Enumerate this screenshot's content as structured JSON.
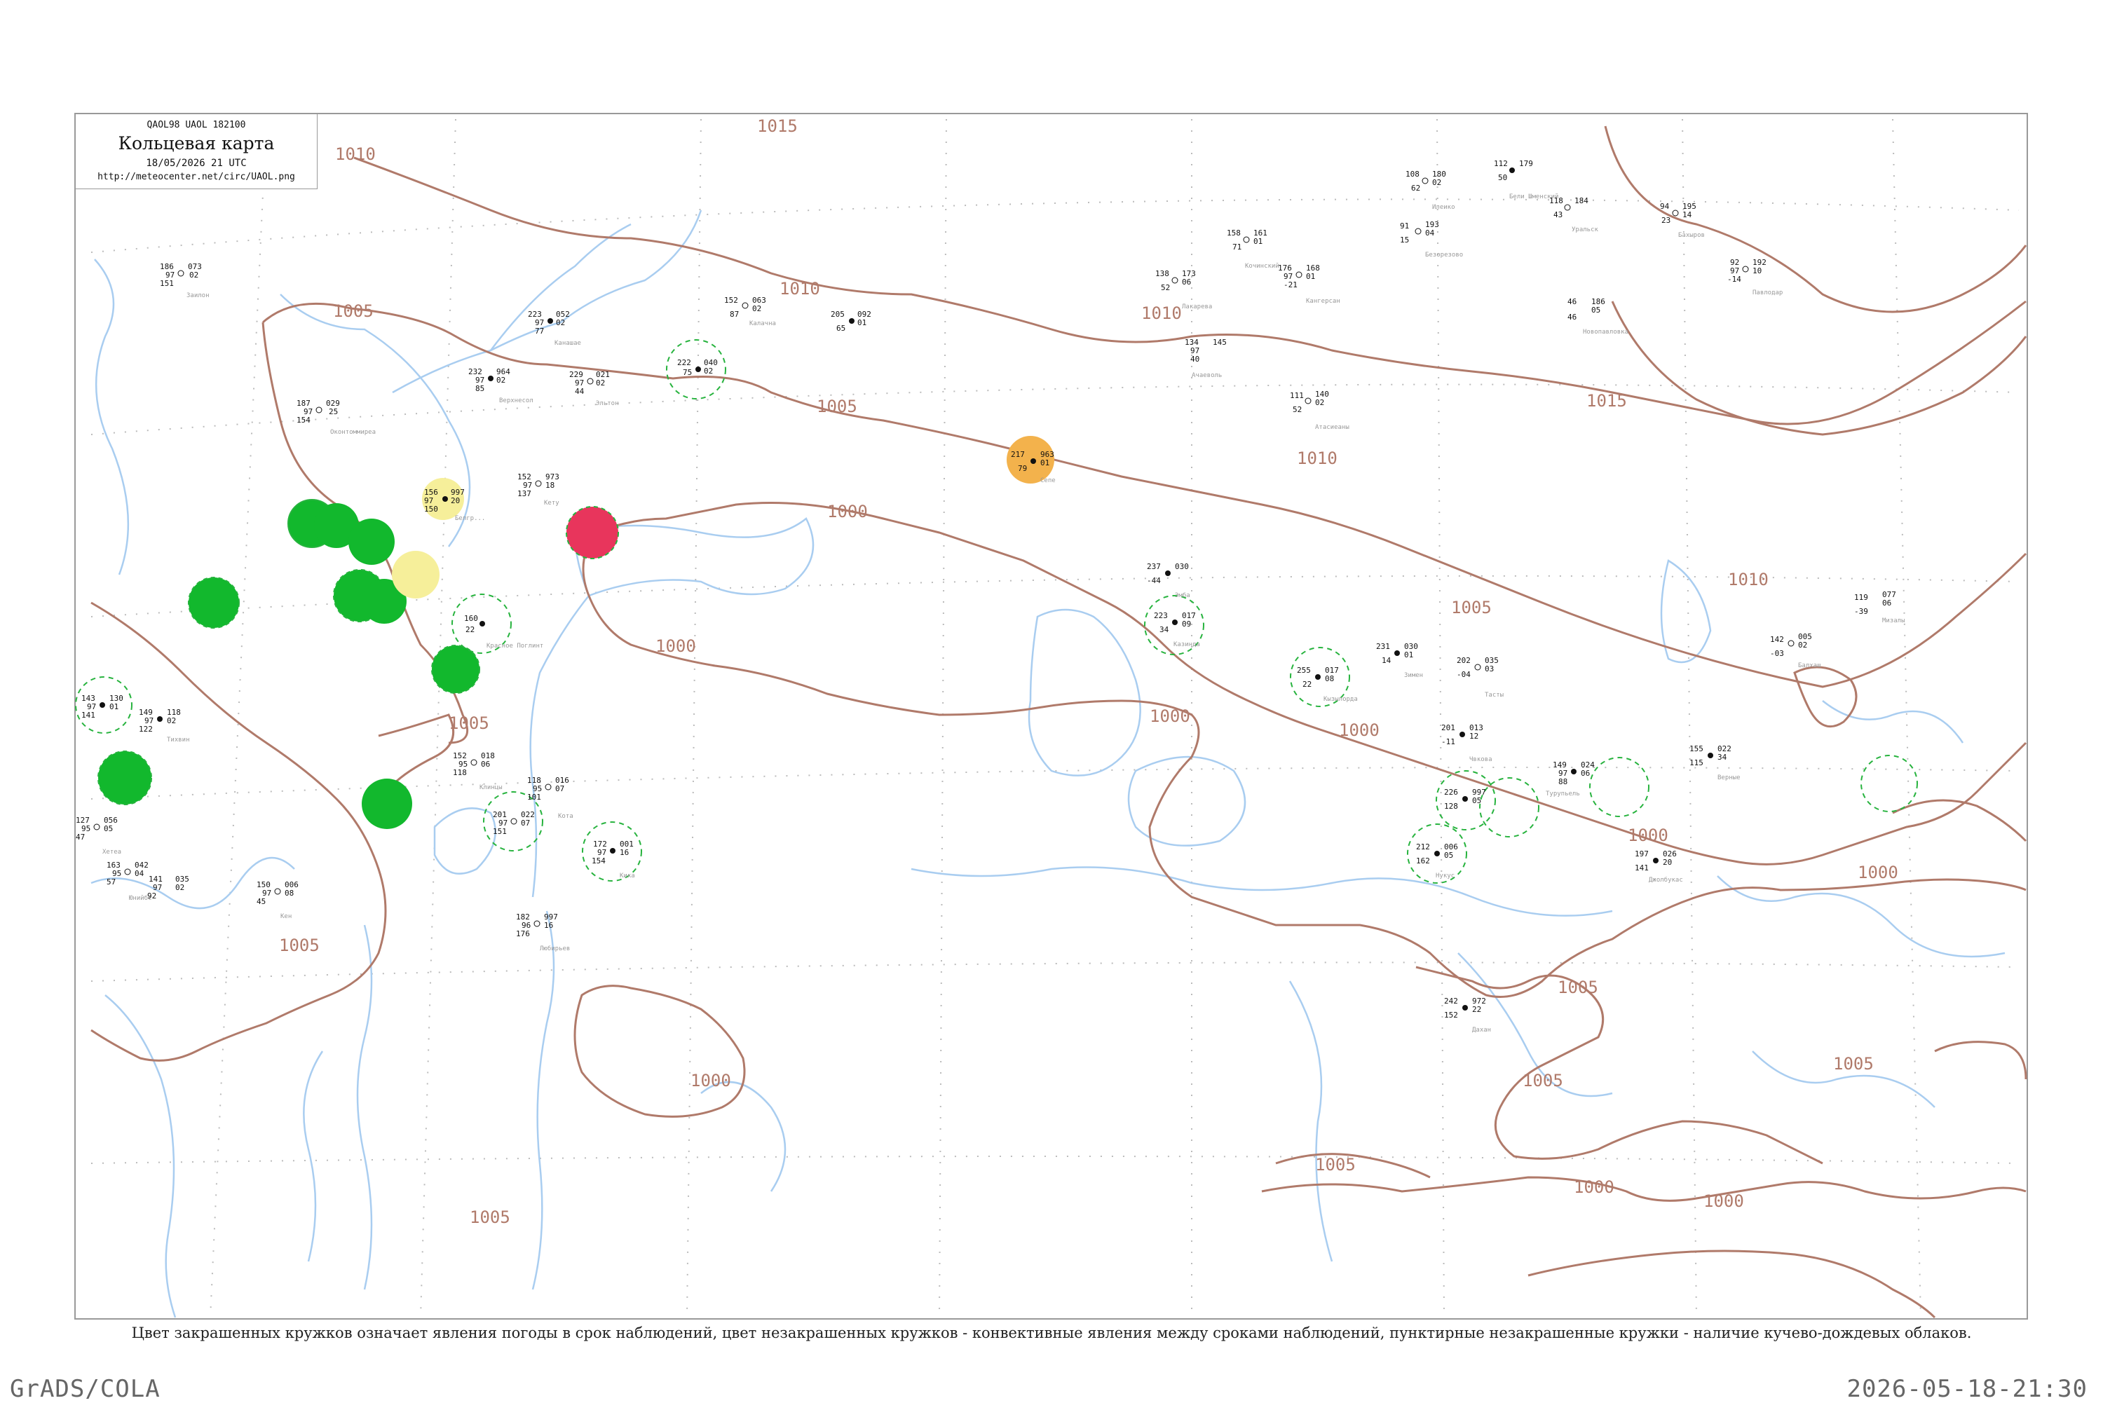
{
  "header": {
    "code": "QAOL98  UAOL  182100",
    "title": "Кольцевая карта",
    "date": "18/05/2026 21 UTC",
    "url": "http://meteocenter.net/circ/UAOL.png"
  },
  "caption": "Цвет закрашенных кружков означает явления погоды в срок наблюдений, цвет незакрашенных кружков - конвективные явления между сроками наблюдений, пунктирные незакрашенные кружки - наличие кучево-дождевых облаков.",
  "footer": {
    "left": "GrADS/COLA",
    "right": "2026-05-18-21:30"
  },
  "colors": {
    "isobar": "#b07a6a",
    "river": "#a9cdf0",
    "grid": "#bbbbbb",
    "green": "#12b82d",
    "yellow": "#f6ef9a",
    "orange": "#f3b24c",
    "red": "#e8355c",
    "dashed_ring": "#27b33e"
  },
  "isobar_labels": [
    "1015",
    "1010",
    "1005",
    "1010",
    "1005",
    "1010",
    "1005",
    "1015",
    "1010",
    "1000",
    "1010",
    "1005",
    "1000",
    "1000",
    "1000",
    "1000",
    "1005",
    "1000",
    "1005",
    "1005",
    "1005",
    "1005",
    "1005",
    "1000",
    "1000",
    "1000"
  ],
  "stations": [
    {
      "p": "186",
      "t": "97",
      "d": "151",
      "n": "073",
      "tend": "02",
      "w": "",
      "name": "Заилон"
    },
    {
      "p": "223",
      "t": "97",
      "d": "77",
      "n": "052",
      "tend": "02",
      "w": "",
      "name": "Канашае"
    },
    {
      "p": "152",
      "t": "87",
      "d": "",
      "n": "063",
      "tend": "02",
      "w": "",
      "name": "Калачна"
    },
    {
      "p": "205",
      "t": "65",
      "d": "",
      "n": "092",
      "tend": "01",
      "w": "",
      "name": ""
    },
    {
      "p": "232",
      "t": "97",
      "d": "85",
      "n": "964",
      "tend": "02",
      "w": "",
      "name": "Верхнесол"
    },
    {
      "p": "229",
      "t": "97",
      "d": "44",
      "n": "021",
      "tend": "02",
      "w": "",
      "name": "Эльтон"
    },
    {
      "p": "222",
      "t": "75",
      "d": "",
      "n": "040",
      "tend": "02",
      "w": "",
      "name": ""
    },
    {
      "p": "187",
      "t": "97",
      "d": "154",
      "n": "029",
      "tend": "25",
      "w": "",
      "name": "Оконтоммиреа"
    },
    {
      "p": "156",
      "t": "97",
      "d": "150",
      "n": "997",
      "tend": "20",
      "w": "",
      "name": "Белгр..."
    },
    {
      "p": "152",
      "t": "97",
      "d": "137",
      "n": "973",
      "tend": "18",
      "w": "",
      "name": "Кету"
    },
    {
      "p": "217",
      "t": "79",
      "d": "",
      "n": "963",
      "tend": "01",
      "w": "",
      "name": "Сепе"
    },
    {
      "p": "108",
      "t": "62",
      "d": "",
      "n": "180",
      "tend": "02",
      "w": "",
      "name": "Илеико"
    },
    {
      "p": "112",
      "t": "50",
      "d": "",
      "n": "179",
      "tend": "",
      "w": "",
      "name": "Бели Шменский"
    },
    {
      "p": "118",
      "t": "43",
      "d": "",
      "n": "184",
      "tend": "",
      "w": "",
      "name": "Уральск"
    },
    {
      "p": "94",
      "t": "23",
      "d": "",
      "n": "195",
      "tend": "14",
      "w": "",
      "name": "Бахыров"
    },
    {
      "p": "158",
      "t": "71",
      "d": "",
      "n": "161",
      "tend": "01",
      "w": "",
      "name": "Кочинский"
    },
    {
      "p": "176",
      "t": "97",
      "d": "-21",
      "n": "168",
      "tend": "01",
      "w": "",
      "name": "Кангерсан"
    },
    {
      "p": "138",
      "t": "52",
      "d": "",
      "n": "173",
      "tend": "06",
      "w": "",
      "name": "Лакарева"
    },
    {
      "p": "91",
      "t": "15",
      "d": "",
      "n": "193",
      "tend": "04",
      "w": "",
      "name": "Безорезово"
    },
    {
      "p": "92",
      "t": "97",
      "d": "-14",
      "n": "192",
      "tend": "10",
      "w": "",
      "name": "Павлодар"
    },
    {
      "p": "46",
      "t": "46",
      "d": "",
      "n": "186",
      "tend": "05",
      "w": "",
      "name": "Новопавловка"
    },
    {
      "p": "134",
      "t": "97",
      "d": "40",
      "n": "145",
      "tend": "",
      "w": "",
      "name": "Ачаеволь"
    },
    {
      "p": "111",
      "t": "52",
      "d": "",
      "n": "140",
      "tend": "02",
      "w": "",
      "name": "Атасиеаны"
    },
    {
      "p": "237",
      "t": "-44",
      "d": "",
      "n": "030",
      "tend": "",
      "w": "",
      "name": "Эмба"
    },
    {
      "p": "223",
      "t": "34",
      "d": "",
      "n": "017",
      "tend": "09",
      "w": "",
      "name": "Казинда"
    },
    {
      "p": "255",
      "t": "22",
      "d": "",
      "n": "017",
      "tend": "08",
      "w": "",
      "name": "Кызылорда"
    },
    {
      "p": "231",
      "t": "14",
      "d": "",
      "n": "030",
      "tend": "01",
      "w": "",
      "name": "Зимен"
    },
    {
      "p": "202",
      "t": "-04",
      "d": "",
      "n": "035",
      "tend": "03",
      "w": "",
      "name": "Тасты"
    },
    {
      "p": "201",
      "t": "-11",
      "d": "",
      "n": "013",
      "tend": "12",
      "w": "",
      "name": "Чвкова"
    },
    {
      "p": "226",
      "t": "128",
      "d": "",
      "n": "997",
      "tend": "05",
      "w": "",
      "name": ""
    },
    {
      "p": "149",
      "t": "97",
      "d": "88",
      "n": "024",
      "tend": "06",
      "w": "",
      "name": "Турупьель"
    },
    {
      "p": "212",
      "t": "162",
      "d": "",
      "n": "006",
      "tend": "05",
      "w": "",
      "name": "Нукус"
    },
    {
      "p": "197",
      "t": "141",
      "d": "",
      "n": "026",
      "tend": "20",
      "w": "",
      "name": "Джолбукас"
    },
    {
      "p": "155",
      "t": "115",
      "d": "",
      "n": "022",
      "tend": "34",
      "w": "",
      "name": "Верные"
    },
    {
      "p": "142",
      "t": "-03",
      "d": "",
      "n": "005",
      "tend": "02",
      "w": "",
      "name": "Балхаш"
    },
    {
      "p": "119",
      "t": "-39",
      "d": "",
      "n": "077",
      "tend": "06",
      "w": "",
      "name": "Мизалы"
    },
    {
      "p": "242",
      "t": "152",
      "d": "",
      "n": "972",
      "tend": "22",
      "w": "",
      "name": "Дахан"
    },
    {
      "p": "143",
      "t": "97",
      "d": "141",
      "n": "130",
      "tend": "01",
      "w": "",
      "name": ""
    },
    {
      "p": "149",
      "t": "97",
      "d": "122",
      "n": "118",
      "tend": "02",
      "w": "",
      "name": "Тихвин"
    },
    {
      "p": "160",
      "t": "22",
      "d": "",
      "n": "",
      "tend": "",
      "w": "",
      "name": "Красное Поглинт"
    },
    {
      "p": "172",
      "t": "97",
      "d": "154",
      "n": "001",
      "tend": "16",
      "w": "",
      "name": "Кика"
    },
    {
      "p": "201",
      "t": "97",
      "d": "151",
      "n": "022",
      "tend": "07",
      "w": "",
      "name": ""
    },
    {
      "p": "182",
      "t": "96",
      "d": "176",
      "n": "997",
      "tend": "16",
      "w": "",
      "name": "Любирьев"
    },
    {
      "p": "152",
      "t": "95",
      "d": "118",
      "n": "018",
      "tend": "06",
      "w": "",
      "name": "Клинцы"
    },
    {
      "p": "118",
      "t": "95",
      "d": "101",
      "n": "016",
      "tend": "07",
      "w": "",
      "name": "Кота"
    },
    {
      "p": "127",
      "t": "95",
      "d": "47",
      "n": "056",
      "tend": "05",
      "w": "",
      "name": "Хетеа"
    },
    {
      "p": "163",
      "t": "95",
      "d": "57",
      "n": "042",
      "tend": "04",
      "w": "",
      "name": "Юнийбс"
    },
    {
      "p": "141",
      "t": "97",
      "d": "92",
      "n": "035",
      "tend": "02",
      "w": "",
      "name": ""
    },
    {
      "p": "150",
      "t": "97",
      "d": "45",
      "n": "006",
      "tend": "08",
      "w": "",
      "name": "Кен"
    }
  ]
}
